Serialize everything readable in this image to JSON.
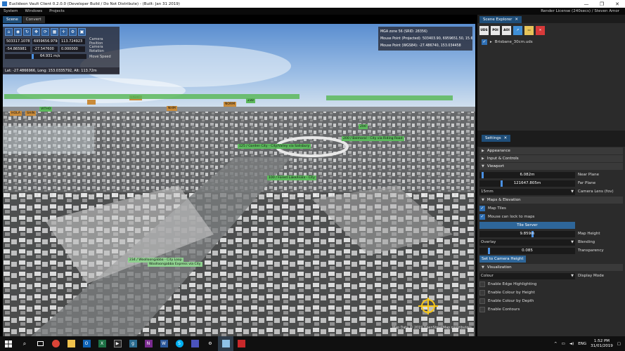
{
  "window": {
    "title": "Euclideon Vault Client 0.2.0.0 (Developer Build / Do Not Distribute) - (Built: Jan 31 2019)",
    "minimize": "—",
    "maximize": "❐",
    "close": "✕"
  },
  "menu": {
    "items": [
      "System",
      "Windows",
      "Projects"
    ],
    "license": "Render License (240secs) / Steven Amor"
  },
  "tabs": [
    {
      "label": "Scene"
    },
    {
      "label": "Convert"
    }
  ],
  "camera": {
    "position": {
      "x": "503317.107814",
      "y": "6959656.979436",
      "z": "113.724923",
      "label": "Camera Position"
    },
    "rotation": {
      "x": "-54.865981",
      "y": "-27.547600",
      "z": "0.000000",
      "label": "Camera Rotation"
    },
    "speed": {
      "value": "64.931 m/s",
      "label": "Move Speed"
    },
    "geo": "Lat: -27.4866966, Long: 153.0335792, Alt: 113.72m"
  },
  "mouse": {
    "zone": "MGA zone 56 (SRID: 28356)",
    "projected": "Mouse Point (Projected): 503403.90, 6959651.50, 15.68",
    "wgs84": "Mouse Point (WGS84): -27.486740, 153.034458"
  },
  "attribution": "Map Data © 2019 OpenStreetMap contributors",
  "map_labels": [
    {
      "text": "125 / Garden City - City/Valley via Salisbury",
      "color": "green"
    },
    {
      "text": "200 / Balmoral - City via Riding Road",
      "color": "green"
    },
    {
      "text": "100 / Forest Lake/Inala - City",
      "color": "green"
    },
    {
      "text": "234 / Woolloongabba - City Loop",
      "color": "lg"
    },
    {
      "text": "Woolloongabba Express via City",
      "color": "lg"
    },
    {
      "text": "NORM",
      "color": "orange"
    },
    {
      "text": "LISHC",
      "color": "orange"
    },
    {
      "text": "NHM",
      "color": "orange"
    },
    {
      "text": "HOLA",
      "color": "orange"
    },
    {
      "text": "SHIN",
      "color": "orange"
    },
    {
      "text": "VITHO",
      "color": "green"
    },
    {
      "text": "230",
      "color": "green"
    },
    {
      "text": "200",
      "color": "green"
    }
  ],
  "scene_explorer": {
    "tab_label": "Scene Explorer",
    "tools": [
      "UDS",
      "POI",
      "AOI",
      "",
      "",
      ""
    ],
    "items": [
      {
        "label": "Brisbane_30cm.uds",
        "checked": true
      }
    ]
  },
  "settings": {
    "tab_label": "Settings",
    "sections": {
      "appearance": "Appearance",
      "input": "Input & Controls",
      "viewport": "Viewport",
      "maps": "Maps & Elevation",
      "visualization": "Visualization"
    },
    "viewport": {
      "near_plane": {
        "value": "6.082m",
        "label": "Near Plane",
        "level": 0.02
      },
      "far_plane": {
        "value": "121647.805m",
        "label": "Far Plane",
        "level": 0.22
      },
      "lens": {
        "value": "15mm",
        "label": "Camera Lens (fov)"
      }
    },
    "maps": {
      "map_tiles": {
        "label": "Map Tiles",
        "checked": true
      },
      "mouse_lock": {
        "label": "Mouse can lock to maps",
        "checked": true
      },
      "tile_server": "Tile Server",
      "map_height": {
        "value": "9.859m",
        "label": "Map Height",
        "level": 0.55
      },
      "blending": {
        "value": "Overlay",
        "label": "Blending"
      },
      "transparency": {
        "value": "0.085",
        "label": "Transparency",
        "level": 0.085
      },
      "set_height_button": "Set to Camera Height"
    },
    "visualization": {
      "display_mode": {
        "value": "Colour",
        "label": "Display Mode"
      },
      "options": [
        {
          "label": "Enable Edge Highlighting",
          "checked": false
        },
        {
          "label": "Enable Colour by Height",
          "checked": false
        },
        {
          "label": "Enable Colour by Depth",
          "checked": false
        },
        {
          "label": "Enable Contours",
          "checked": false
        }
      ]
    }
  },
  "taskbar": {
    "apps": [
      "X",
      "O",
      "X",
      "N",
      "g",
      "W",
      "S"
    ],
    "lang": "ENG",
    "time": "1:52 PM",
    "date": "31/01/2019"
  }
}
